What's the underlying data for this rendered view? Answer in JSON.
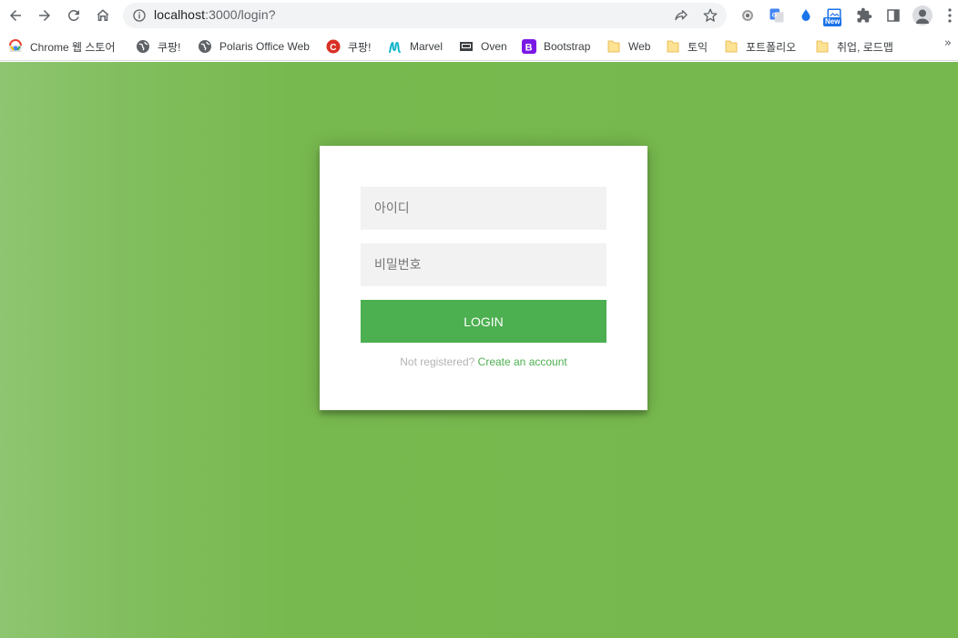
{
  "browser": {
    "url_host": "localhost",
    "url_path": ":3000/login?",
    "new_badge": "New",
    "bookmarks": [
      {
        "label": "Chrome 웹 스토어",
        "icon": "chrome-web-store-icon"
      },
      {
        "label": "쿠팡!",
        "icon": "globe-icon"
      },
      {
        "label": "Polaris Office Web",
        "icon": "globe-icon"
      },
      {
        "label": "쿠팡!",
        "icon": "coupang-c-icon"
      },
      {
        "label": "Marvel",
        "icon": "marvel-icon"
      },
      {
        "label": "Oven",
        "icon": "oven-icon"
      },
      {
        "label": "Bootstrap",
        "icon": "bootstrap-icon"
      },
      {
        "label": "Web",
        "icon": "folder-icon"
      },
      {
        "label": "토익",
        "icon": "folder-icon"
      },
      {
        "label": "포트폴리오",
        "icon": "folder-icon"
      },
      {
        "label": "취업, 로드맵",
        "icon": "folder-icon"
      }
    ],
    "more_bookmarks": "»"
  },
  "login": {
    "id_placeholder": "아이디",
    "password_placeholder": "비밀번호",
    "button_label": "LOGIN",
    "register_prompt": "Not registered?",
    "register_link": "Create an account"
  },
  "colors": {
    "accent": "#4caf50",
    "background": "#76b84d",
    "card": "#ffffff",
    "field": "#f2f2f2"
  }
}
